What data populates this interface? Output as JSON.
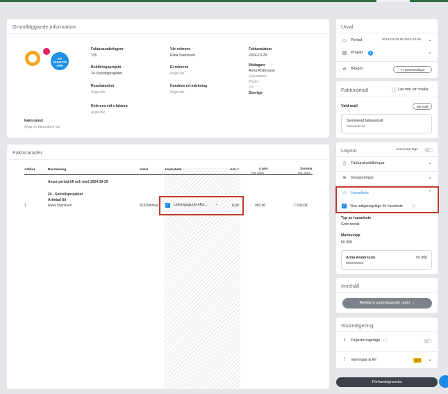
{
  "basic_info": {
    "title": "Grundläggande information",
    "logo_text": [
      "ER",
      "LOGOTYP",
      "HÄR"
    ],
    "invoice_basis_label": "Fakturaunderlagsnr",
    "invoice_basis_value": "115",
    "our_ref_label": "Vår referens",
    "our_ref_value": "Elina Svensson",
    "invoice_date_label": "Fakturadatum",
    "invoice_date_value": "2024-10-25",
    "booking_project_label": "Bokföringsprojekt",
    "booking_project_value": "24 Solcellsprojektet",
    "your_ref_label": "Er referens",
    "your_ref_placeholder": "Ange här",
    "recipient_label": "Mottagare",
    "recipient_name": "Anna Andersson",
    "recipient_address_placeholder": "Gatuadress",
    "recipient_zip_placeholder": "Postnr",
    "recipient_city_placeholder": "Ort",
    "recipient_country": "Sverige",
    "result_unit_label": "Resultatenhet",
    "result_unit_placeholder": "Ange här",
    "customer_ref_label": "Kundens ref.märkning",
    "customer_ref_placeholder": "Ange här",
    "einvoice_ref_label": "Referens vid e-faktura",
    "einvoice_ref_placeholder": "Ange här",
    "invoice_text_label": "Fakturatext",
    "invoice_text_placeholder": "Ange en fakturatext här"
  },
  "invoice_rows": {
    "title": "Fakturarader",
    "columns": {
      "article": "Artikel",
      "name": "Benämning",
      "quantity": "Antal",
      "rot": "Husarbete",
      "work_hours": "Arb. t",
      "price": "á pris",
      "price_sub": "exkl. moms",
      "sum": "Summa",
      "sum_sub": "exkl. moms"
    },
    "period_text": "Avser period till och med 2024-10-25",
    "project_text": "24 - Solcellsprojektet",
    "work_label": "Arbetad tid",
    "row": {
      "article": "1",
      "name": "Elina Svensson",
      "quantity": "8,00 timmar",
      "rot_select": "Ledningsgjuckt effor...",
      "work_hours": "8,00",
      "price": "950,00",
      "sum": "7 600,00"
    }
  },
  "selection": {
    "title": "Urval",
    "period_label": "Period",
    "period_value": "2024-03-25 till 2024-10-25",
    "project_label": "Projekt",
    "project_count": "1",
    "attachments_label": "Bilagor",
    "attachments_button": "Hantera bilagor"
  },
  "template": {
    "title": "Fakturamall",
    "read_more": "Läs mer om mallar",
    "chosen_label": "Vald mall",
    "change_button": "Byt mall",
    "template_name": "Summerad fakturamall",
    "template_sub": "Standardmall"
  },
  "layout": {
    "title": "Layout",
    "advanced_label": "Avancerat läge",
    "invoice_settings": "Fakturainställningar",
    "groupings": "Grupperingar",
    "rot_label": "Husarbete",
    "rot_edit_mode": "Visa redigeringsläge för husarbete",
    "rot_type_label": "Typ av husarbete",
    "rot_type_value": "Grön teknik",
    "max_amount_label": "Maxbelopp",
    "max_amount_value": "50 000",
    "person_name": "Anna Andersson",
    "person_amount": "50.000",
    "person_id": "9909090909"
  },
  "content": {
    "title": "Innehåll",
    "edit_button": "Redigera underliggande rader"
  },
  "final_edit": {
    "title": "Slutredigering",
    "fine_tune": "Finjusteringsläge",
    "warnings": "Varningar & fel",
    "warnings_count": "1"
  },
  "preview_button": "Förhandsgranska",
  "colors": {
    "accent_blue": "#1e88e5",
    "highlight_red": "#c0392b",
    "preview_dark": "#3b4049"
  }
}
